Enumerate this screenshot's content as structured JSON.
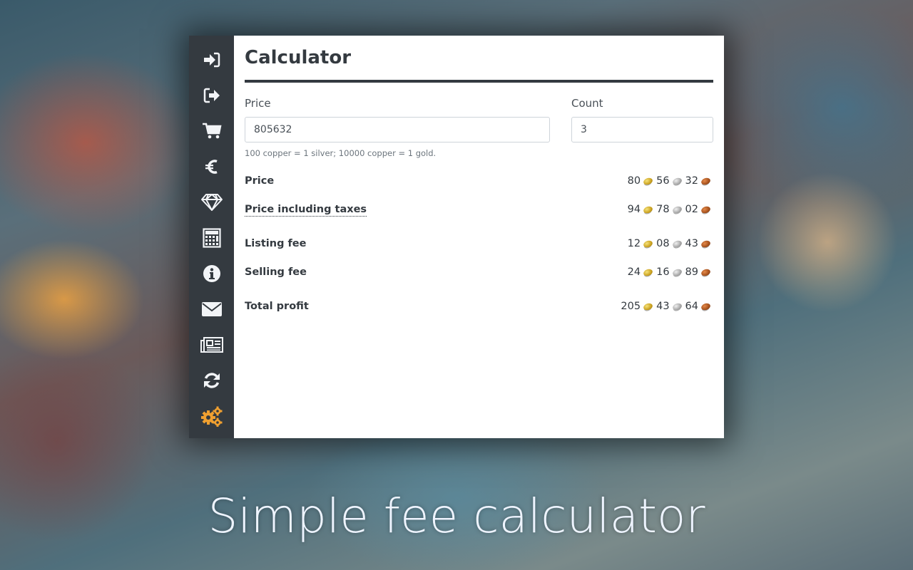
{
  "sidebar": {
    "items": [
      {
        "name": "sign-in",
        "icon": "sign-in-icon"
      },
      {
        "name": "sign-out",
        "icon": "sign-out-icon"
      },
      {
        "name": "cart",
        "icon": "shopping-cart-icon"
      },
      {
        "name": "currency",
        "icon": "euro-icon"
      },
      {
        "name": "gems",
        "icon": "diamond-icon"
      },
      {
        "name": "calculator",
        "icon": "calculator-icon",
        "active": true
      },
      {
        "name": "info",
        "icon": "info-icon"
      },
      {
        "name": "mail",
        "icon": "envelope-icon"
      },
      {
        "name": "news",
        "icon": "newspaper-icon"
      },
      {
        "name": "refresh",
        "icon": "refresh-icon"
      },
      {
        "name": "settings",
        "icon": "gears-icon",
        "color": "#f0a030"
      }
    ]
  },
  "panel": {
    "title": "Calculator",
    "price_label": "Price",
    "price_value": "805632",
    "count_label": "Count",
    "count_value": "3",
    "help_text": "100 copper = 1 silver; 10000 copper = 1 gold."
  },
  "results": [
    {
      "label": "Price",
      "gold": "80",
      "silver": "56",
      "copper": "32"
    },
    {
      "label": "Price including taxes",
      "gold": "94",
      "silver": "78",
      "copper": "02"
    },
    {
      "label": "Listing fee",
      "gold": "12",
      "silver": "08",
      "copper": "43"
    },
    {
      "label": "Selling fee",
      "gold": "24",
      "silver": "16",
      "copper": "89"
    },
    {
      "label": "Total profit",
      "gold": "205",
      "silver": "43",
      "copper": "64"
    }
  ],
  "caption": "Simple fee calculator",
  "colors": {
    "sidebar_bg": "#343a40",
    "icon": "#f2f4f7",
    "settings_icon": "#f0a030",
    "text_dark": "#343a40"
  }
}
